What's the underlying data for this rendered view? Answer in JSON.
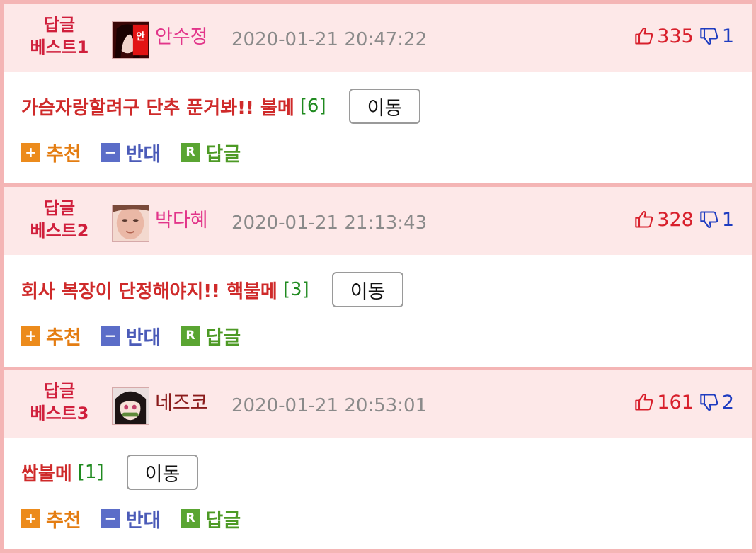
{
  "comments": [
    {
      "rank_line1": "답글",
      "rank_line2": "베스트1",
      "avatar_icon": "avatar-red-icon",
      "username": "안수정",
      "date": "2020-01-21 20:47:22",
      "up_count": "335",
      "down_count": "1",
      "title": "가슴자랑할려구 단추 푼거봐!! 불메",
      "comment_count": "[6]",
      "move_label": "이동"
    },
    {
      "rank_line1": "답글",
      "rank_line2": "베스트2",
      "avatar_icon": "avatar-face-icon",
      "username": "박다혜",
      "date": "2020-01-21 21:13:43",
      "up_count": "328",
      "down_count": "1",
      "title": "회사 복장이 단정해야지!! 핵불메",
      "comment_count": "[3]",
      "move_label": "이동"
    },
    {
      "rank_line1": "답글",
      "rank_line2": "베스트3",
      "avatar_icon": "avatar-anime-icon",
      "username": "네즈코",
      "date": "2020-01-21 20:53:01",
      "up_count": "161",
      "down_count": "2",
      "title": "쌉불메",
      "comment_count": "[1]",
      "move_label": "이동"
    }
  ],
  "actions": {
    "recommend_label": "추천",
    "recommend_symbol": "+",
    "oppose_label": "반대",
    "oppose_symbol": "−",
    "reply_label": "답글",
    "reply_symbol": "R"
  },
  "colors": {
    "accent_red": "#d01f3c",
    "header_bg": "#fde8e8",
    "border_pink": "#f4b5b5",
    "username_pink": "#e2358a",
    "comment_count_green": "#1f8a1f"
  }
}
